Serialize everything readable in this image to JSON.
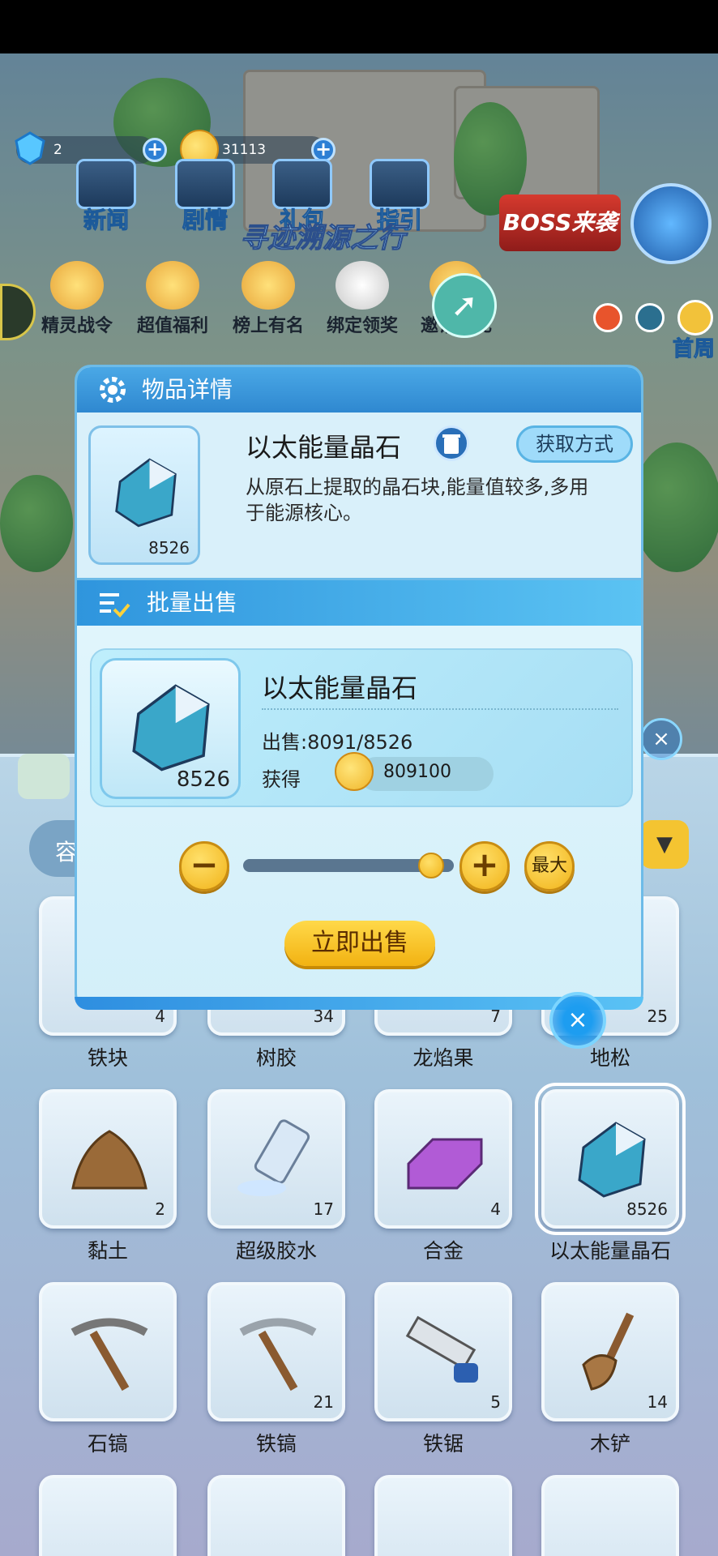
{
  "hud": {
    "gems": "2",
    "coins": "31113"
  },
  "top_buttons": [
    "新闻",
    "剧情",
    "礼包",
    "指引"
  ],
  "banner_text": "寻迹溯源之行",
  "boss_label": "BOSS来袭",
  "row_buttons": [
    "精灵战令",
    "超值福利",
    "榜上有名",
    "绑定领奖",
    "邀请有礼"
  ],
  "map_label": "首周",
  "inventory": {
    "category_label": "容",
    "items": [
      {
        "name": "铁块",
        "count": "4"
      },
      {
        "name": "树胶",
        "count": "34"
      },
      {
        "name": "龙焰果",
        "count": "7"
      },
      {
        "name": "地松",
        "count": "25"
      },
      {
        "name": "黏土",
        "count": "2"
      },
      {
        "name": "超级胶水",
        "count": "17"
      },
      {
        "name": "合金",
        "count": "4"
      },
      {
        "name": "以太能量晶石",
        "count": "8526"
      },
      {
        "name": "石镐",
        "count": ""
      },
      {
        "name": "铁镐",
        "count": "21"
      },
      {
        "name": "铁锯",
        "count": "5"
      },
      {
        "name": "木铲",
        "count": "14"
      }
    ]
  },
  "detail": {
    "header": "物品详情",
    "item_name": "以太能量晶石",
    "count": "8526",
    "acquire_label": "获取方式",
    "description": "从原石上提取的晶石块,能量值较多,多用于能源核心。"
  },
  "sell": {
    "header": "批量出售",
    "item_name": "以太能量晶石",
    "count": "8526",
    "sold_text": "出售:8091/8526",
    "gain_label": "获得",
    "gain_value": "809100",
    "minus": "−",
    "plus": "+",
    "max_label": "最大",
    "slider_fraction": 0.949,
    "sell_button": "立即出售",
    "close": "×"
  }
}
